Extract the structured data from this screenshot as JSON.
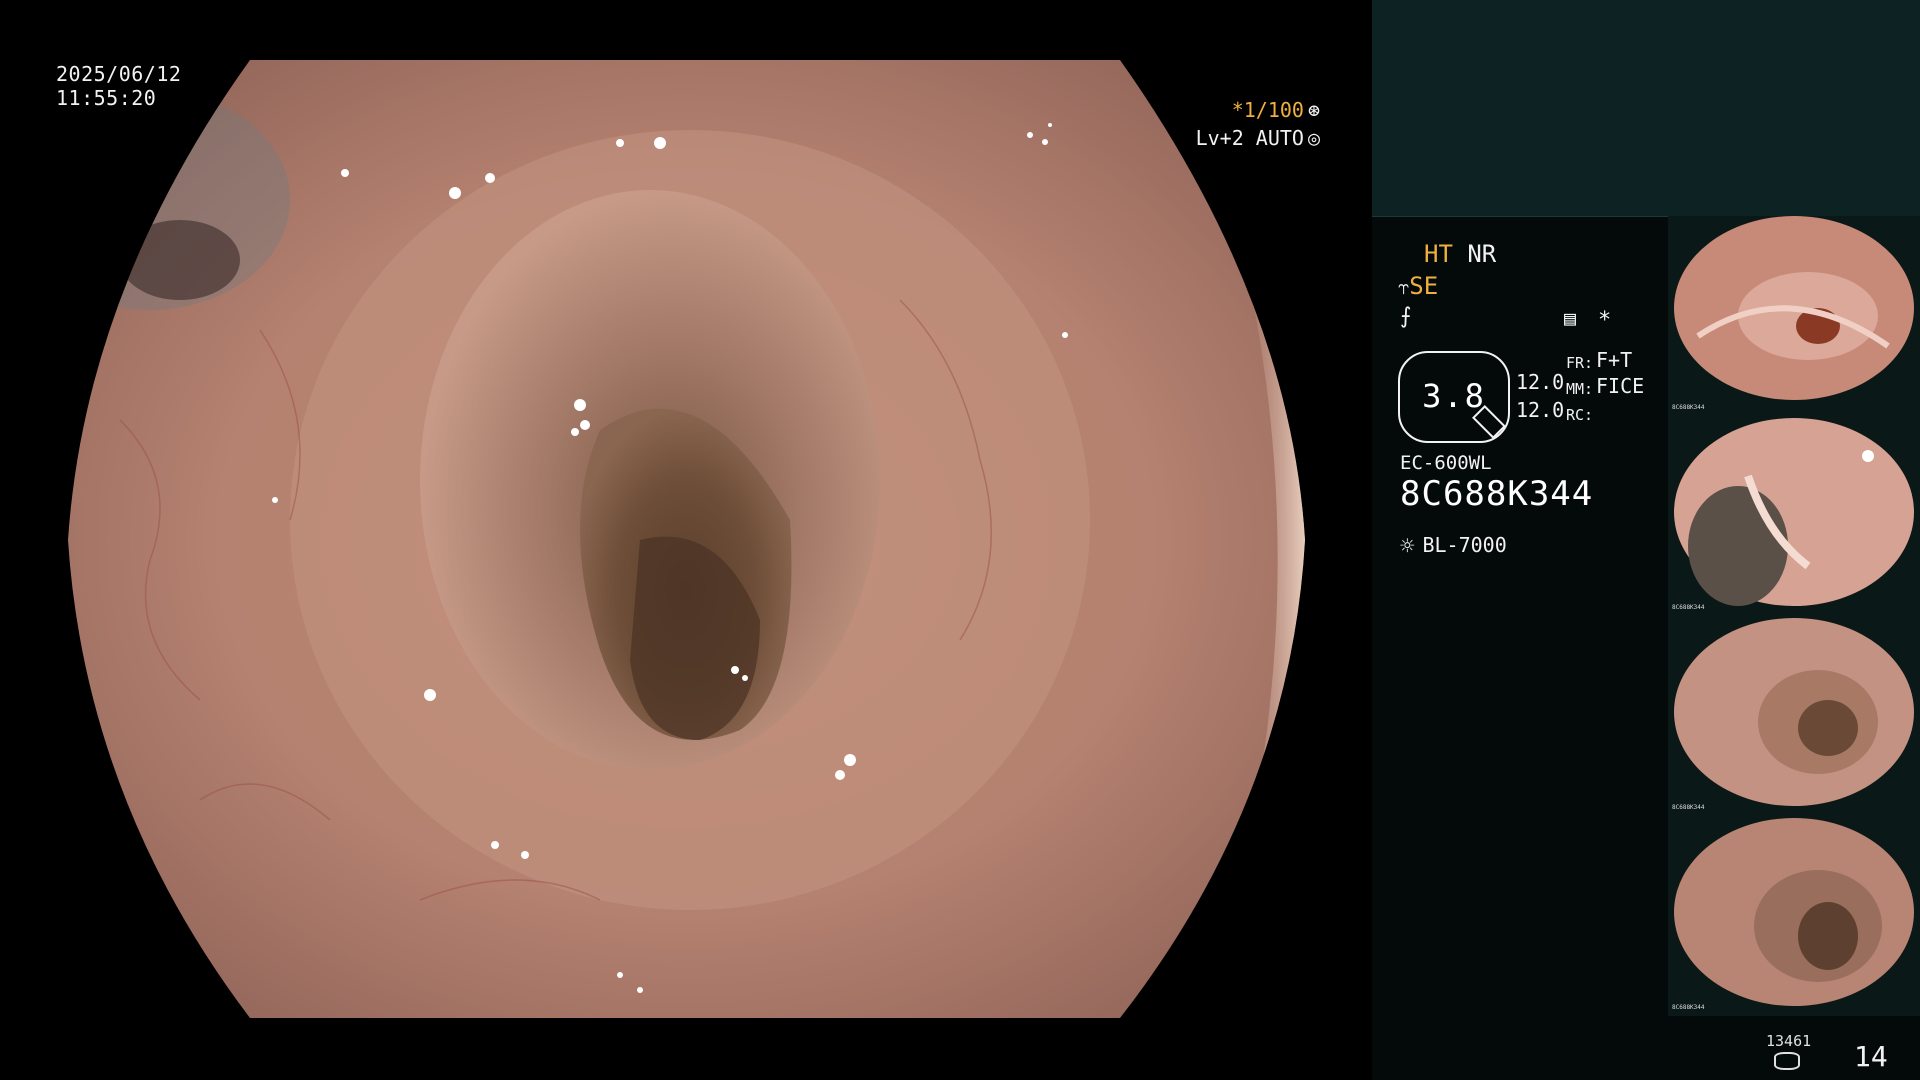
{
  "overlay": {
    "date": "2025/06/12",
    "time": "11:55:20",
    "shutter_speed": "*1/100",
    "shutter_icon": "aperture-icon",
    "light_level": "Lv+2 AUTO",
    "light_icon": "iris-icon"
  },
  "side_panel": {
    "mode_ht": "HT",
    "mode_nr": "NR",
    "mode_se": "SE",
    "se_icon": "scope-tip-icon",
    "curve_icon": "curve-icon",
    "menu_icon": "settings-menu-icon",
    "star": "*",
    "zoom_value": "3.8",
    "fr_label": "FR:",
    "fr_value": "F+T",
    "mm_label": "MM:",
    "mm_value": "FICE",
    "rc_label": "RC:",
    "rc_value": "",
    "num_1": "12.0",
    "num_2": "12.0",
    "scope_model": "EC-600WL",
    "scope_serial": "8C688K344",
    "light_icon": "sun-icon",
    "light_source": "BL-7000",
    "thumb_serial": "8C688K344"
  },
  "footer": {
    "image_count_small": "13461",
    "storage_icon": "disk-icon",
    "image_count_big": "14"
  },
  "colors": {
    "accent_orange": "#f0b040",
    "panel_dark_teal": "#0d2222",
    "tissue_pink": "#c08a78"
  }
}
